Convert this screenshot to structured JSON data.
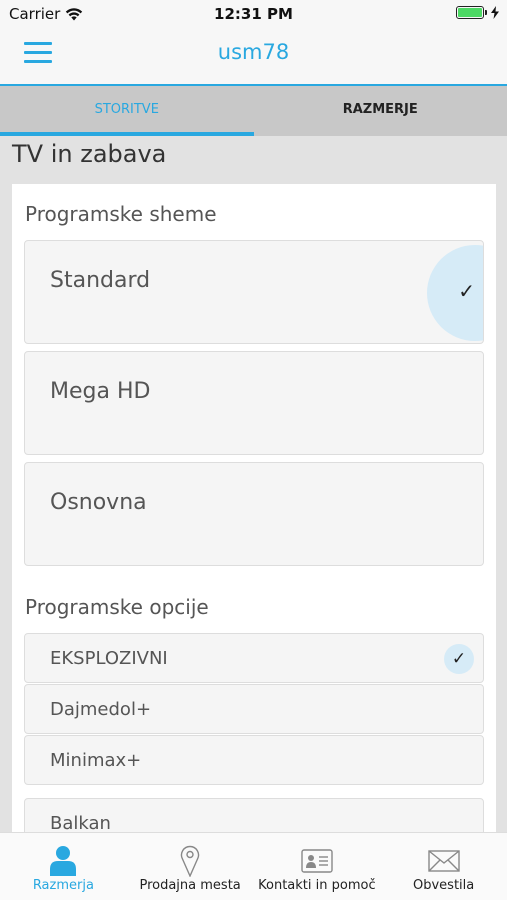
{
  "status_bar": {
    "carrier": "Carrier",
    "time": "12:31 PM",
    "battery_level": 1.0,
    "icons": [
      "wifi-icon",
      "battery-icon",
      "charging-icon"
    ]
  },
  "navbar": {
    "title": "usm78",
    "accent_color": "#29a8e0",
    "menu_icon": "hamburger-menu-icon"
  },
  "tabs": [
    {
      "label": "STORITVE",
      "active": true
    },
    {
      "label": "RAZMERJE",
      "active": false
    }
  ],
  "page_title": "TV in zabava",
  "schemes": {
    "heading": "Programske sheme",
    "items": [
      {
        "label": "Standard",
        "selected": true
      },
      {
        "label": "Mega HD",
        "selected": false
      },
      {
        "label": "Osnovna",
        "selected": false
      }
    ]
  },
  "options": {
    "heading": "Programske opcije",
    "items": [
      {
        "label": "EKSPLOZIVNI",
        "selected": true
      },
      {
        "label": "Dajmedol+",
        "selected": false
      },
      {
        "label": "Minimax+",
        "selected": false
      },
      {
        "label": "Balkan",
        "selected": false
      }
    ]
  },
  "bottom_nav": [
    {
      "label": "Razmerja",
      "icon": "person-icon",
      "active": true
    },
    {
      "label": "Prodajna mesta",
      "icon": "location-pin-icon",
      "active": false
    },
    {
      "label": "Kontakti in pomoč",
      "icon": "contact-card-icon",
      "active": false
    },
    {
      "label": "Obvestila",
      "icon": "envelope-icon",
      "active": false
    }
  ]
}
